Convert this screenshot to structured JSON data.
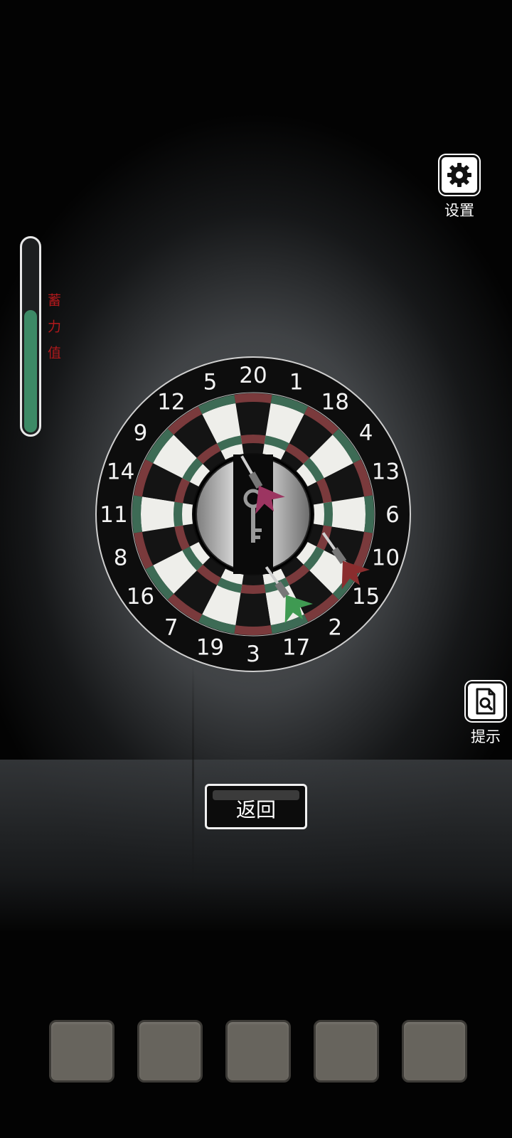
{
  "power_meter": {
    "label": "蓄力值",
    "level": 0.65
  },
  "settings": {
    "label": "设置",
    "icon": "gear-icon"
  },
  "hint": {
    "label": "提示",
    "icon": "document-search-icon"
  },
  "return_button": {
    "label": "返回"
  },
  "dartboard": {
    "numbers": [
      "20",
      "1",
      "18",
      "4",
      "13",
      "6",
      "10",
      "15",
      "2",
      "17",
      "3",
      "19",
      "7",
      "16",
      "8",
      "11",
      "14",
      "9",
      "12",
      "5"
    ],
    "center_item": "key",
    "darts": [
      "magenta",
      "red",
      "green"
    ]
  },
  "inventory": {
    "slots": 5
  },
  "colors": {
    "power_fill": "#3d8a66",
    "power_label": "#b0191c",
    "board_red_ring": "#7a3a3c",
    "board_green_ring": "#3d6b55",
    "dart_magenta": "#9c3561",
    "dart_red": "#8a2d2e",
    "dart_green": "#3f9a52"
  }
}
